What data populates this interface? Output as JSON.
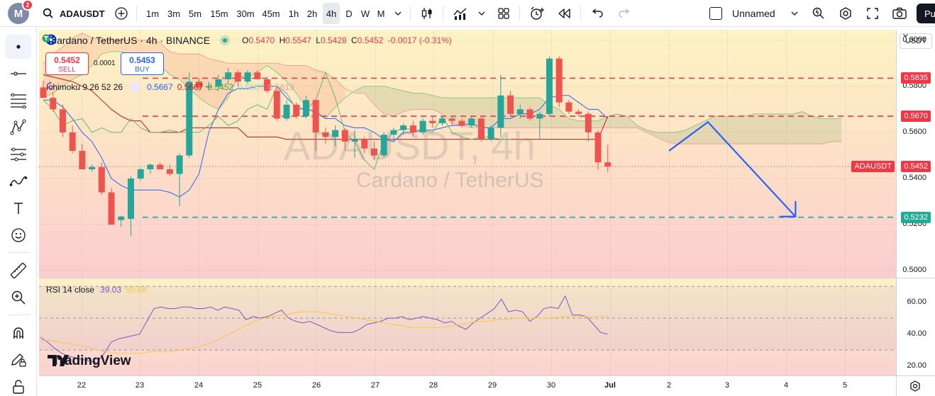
{
  "toolbar": {
    "avatar_letter": "M",
    "notifications": "2",
    "symbol": "ADAUSDT",
    "intervals": [
      "1m",
      "3m",
      "5m",
      "15m",
      "30m",
      "45m",
      "1h",
      "2h",
      "4h",
      "D",
      "W",
      "M"
    ],
    "selected_interval": "4h",
    "layout_name": "Unnamed",
    "publish_label": "Pu"
  },
  "legend": {
    "title": "Cardano / TetherUS · 4h · BINANCE",
    "o_label": "O",
    "o": "0.5470",
    "h_label": "H",
    "h": "0.5547",
    "l_label": "L",
    "l": "0.5428",
    "c_label": "C",
    "c": "0.5452",
    "change": "-0.0017 (-0.31%)",
    "sell_price": "0.5452",
    "sell_label": "SELL",
    "spread": "0.0001",
    "buy_price": "0.5453",
    "buy_label": "BUY",
    "ichimoku_name": "Ichimoku 9 26 52 26",
    "ichimoku_values": [
      "0.5667",
      "0.5667",
      "0.5452",
      "0.5667",
      "0.5613"
    ],
    "rsi_name": "RSI 14 close",
    "rsi_values": [
      "39.03",
      "50.68"
    ]
  },
  "watermark": {
    "symbol": "ADAUSDT, 4h",
    "name": "Cardano / TetherUS"
  },
  "brand": "TradingView",
  "currency": "USDT",
  "colors": {
    "up": "#26a69a",
    "down": "#ef5350",
    "blue": "#2962ff",
    "purple": "#7e57c2",
    "rsi_ma": "#f7c948"
  },
  "price_axis": {
    "ticks": [
      "0.6000",
      "0.5800",
      "0.5600",
      "0.5400",
      "0.5200",
      "0.5000"
    ],
    "tick_values": [
      0.6,
      0.58,
      0.56,
      0.54,
      0.52,
      0.5
    ],
    "labels": [
      {
        "value": 0.5835,
        "text": "0.5835",
        "color": "#f23645"
      },
      {
        "value": 0.567,
        "text": "0.5670",
        "color": "#f23645"
      },
      {
        "value": 0.5452,
        "text": "0.5452",
        "color": "#f23645",
        "tag": "ADAUSDT"
      },
      {
        "value": 0.5232,
        "text": "0.5232",
        "color": "#22ab94"
      }
    ]
  },
  "rsi_axis": {
    "ticks": [
      "60.00",
      "40.00",
      "20.00"
    ],
    "tick_values": [
      60,
      40,
      20
    ]
  },
  "time_axis": {
    "labels": [
      "22",
      "23",
      "24",
      "25",
      "26",
      "27",
      "28",
      "29",
      "30",
      "Jul",
      "2",
      "3",
      "4",
      "5"
    ],
    "bold": "Jul"
  },
  "chart_data": {
    "type": "candlestick",
    "title": "Cardano / TetherUS · 4h · BINANCE",
    "ylim": [
      0.497,
      0.6045
    ],
    "levels": [
      {
        "name": "resistance-1",
        "value": 0.5835,
        "color": "#f23645"
      },
      {
        "name": "resistance-2",
        "value": 0.567,
        "color": "#f23645"
      },
      {
        "name": "support",
        "value": 0.5232,
        "color": "#22ab94"
      }
    ],
    "projection": [
      [
        0,
        0.552
      ],
      [
        4,
        0.5645
      ],
      [
        13,
        0.5235
      ]
    ],
    "candles": [
      [
        0.5795,
        0.5825,
        0.576,
        0.575
      ],
      [
        0.575,
        0.5775,
        0.569,
        0.57
      ],
      [
        0.57,
        0.572,
        0.558,
        0.56
      ],
      [
        0.56,
        0.563,
        0.551,
        0.552
      ],
      [
        0.552,
        0.555,
        0.547,
        0.544
      ],
      [
        0.544,
        0.546,
        0.543,
        0.545
      ],
      [
        0.545,
        0.547,
        0.533,
        0.534
      ],
      [
        0.534,
        0.536,
        0.521,
        0.52
      ],
      [
        0.522,
        0.524,
        0.519,
        0.5235
      ],
      [
        0.5225,
        0.541,
        0.515,
        0.54
      ],
      [
        0.54,
        0.5445,
        0.539,
        0.544
      ],
      [
        0.544,
        0.5465,
        0.542,
        0.546
      ],
      [
        0.546,
        0.547,
        0.544,
        0.544
      ],
      [
        0.544,
        0.546,
        0.541,
        0.542
      ],
      [
        0.542,
        0.551,
        0.528,
        0.55
      ],
      [
        0.55,
        0.586,
        0.549,
        0.582
      ],
      [
        0.582,
        0.5835,
        0.578,
        0.5795
      ],
      [
        0.5795,
        0.582,
        0.578,
        0.58
      ],
      [
        0.58,
        0.585,
        0.578,
        0.583
      ],
      [
        0.583,
        0.588,
        0.581,
        0.586
      ],
      [
        0.586,
        0.587,
        0.58,
        0.582
      ],
      [
        0.582,
        0.587,
        0.581,
        0.586
      ],
      [
        0.586,
        0.587,
        0.583,
        0.583
      ],
      [
        0.583,
        0.584,
        0.577,
        0.578
      ],
      [
        0.578,
        0.58,
        0.565,
        0.566
      ],
      [
        0.566,
        0.574,
        0.565,
        0.572
      ],
      [
        0.572,
        0.573,
        0.566,
        0.567
      ],
      [
        0.567,
        0.576,
        0.566,
        0.574
      ],
      [
        0.574,
        0.5745,
        0.552,
        0.56
      ],
      [
        0.56,
        0.562,
        0.555,
        0.558
      ],
      [
        0.558,
        0.563,
        0.554,
        0.561
      ],
      [
        0.561,
        0.562,
        0.552,
        0.556
      ],
      [
        0.556,
        0.561,
        0.549,
        0.557
      ],
      [
        0.557,
        0.558,
        0.551,
        0.553
      ],
      [
        0.553,
        0.556,
        0.548,
        0.55
      ],
      [
        0.55,
        0.56,
        0.549,
        0.559
      ],
      [
        0.559,
        0.562,
        0.556,
        0.561
      ],
      [
        0.561,
        0.564,
        0.559,
        0.563
      ],
      [
        0.563,
        0.565,
        0.558,
        0.56
      ],
      [
        0.56,
        0.566,
        0.559,
        0.565
      ],
      [
        0.565,
        0.567,
        0.562,
        0.564
      ],
      [
        0.564,
        0.567,
        0.563,
        0.566
      ],
      [
        0.566,
        0.567,
        0.563,
        0.565
      ],
      [
        0.565,
        0.566,
        0.562,
        0.563
      ],
      [
        0.563,
        0.567,
        0.562,
        0.566
      ],
      [
        0.566,
        0.567,
        0.556,
        0.557
      ],
      [
        0.557,
        0.563,
        0.556,
        0.562
      ],
      [
        0.562,
        0.585,
        0.558,
        0.576
      ],
      [
        0.576,
        0.578,
        0.567,
        0.568
      ],
      [
        0.568,
        0.572,
        0.566,
        0.57
      ],
      [
        0.57,
        0.571,
        0.565,
        0.566
      ],
      [
        0.566,
        0.569,
        0.557,
        0.568
      ],
      [
        0.568,
        0.593,
        0.567,
        0.592
      ],
      [
        0.592,
        0.593,
        0.571,
        0.573
      ],
      [
        0.573,
        0.574,
        0.568,
        0.569
      ],
      [
        0.569,
        0.57,
        0.567,
        0.568
      ],
      [
        0.568,
        0.569,
        0.556,
        0.56
      ],
      [
        0.56,
        0.561,
        0.544,
        0.547
      ],
      [
        0.547,
        0.5547,
        0.5428,
        0.5452
      ]
    ],
    "ichimoku": {
      "conversion": [
        0.574,
        0.574,
        0.571,
        0.566,
        0.56,
        0.556,
        0.549,
        0.54,
        0.537,
        0.535,
        0.535,
        0.535,
        0.535,
        0.534,
        0.532,
        0.535,
        0.542,
        0.56,
        0.57,
        0.577,
        0.579,
        0.579,
        0.58,
        0.58,
        0.58,
        0.575,
        0.571,
        0.57,
        0.569,
        0.566,
        0.566,
        0.563,
        0.562,
        0.562,
        0.56,
        0.557,
        0.556,
        0.56,
        0.56,
        0.561,
        0.561,
        0.562,
        0.563,
        0.563,
        0.564,
        0.562,
        0.562,
        0.566,
        0.566,
        0.568,
        0.568,
        0.57,
        0.575,
        0.576,
        0.576,
        0.573,
        0.57,
        0.57,
        0.566
      ],
      "base": [
        0.585,
        0.584,
        0.583,
        0.582,
        0.58,
        0.578,
        0.574,
        0.57,
        0.567,
        0.565,
        0.565,
        0.56,
        0.56,
        0.56,
        0.56,
        0.562,
        0.562,
        0.562,
        0.562,
        0.562,
        0.562,
        0.558,
        0.558,
        0.558,
        0.558,
        0.557,
        0.557,
        0.557,
        0.557,
        0.557,
        0.557,
        0.557,
        0.557,
        0.557,
        0.557,
        0.557,
        0.557,
        0.557,
        0.557,
        0.557,
        0.557,
        0.557,
        0.557,
        0.557,
        0.557,
        0.557,
        0.557,
        0.557,
        0.557,
        0.557,
        0.557,
        0.557,
        0.557,
        0.557,
        0.557,
        0.557,
        0.557,
        0.557,
        0.567
      ],
      "lagging": [
        0.574,
        0.57,
        0.563,
        0.565,
        0.566,
        0.56,
        0.562,
        0.56,
        0.56,
        0.566,
        0.562,
        0.56,
        0.56,
        0.561,
        0.56,
        0.56,
        0.56,
        0.563,
        0.567,
        0.563,
        0.565,
        0.57,
        0.572,
        0.57,
        0.58,
        0.577,
        0.57,
        0.57,
        0.574,
        0.586,
        0.575,
        0.56,
        0.556,
        0.548,
        0.544,
        0.556,
        0.56,
        0.562,
        0.561,
        0.561,
        0.56,
        0.567,
        0.56,
        0.558,
        0.557,
        0.558,
        0.558,
        0.557,
        0.557
      ],
      "span_a": [
        0.575,
        0.577,
        0.58,
        0.583,
        0.585,
        0.589,
        0.594,
        0.595,
        0.595,
        0.594,
        0.593,
        0.59,
        0.589,
        0.585,
        0.583,
        0.579,
        0.575,
        0.572,
        0.57,
        0.575,
        0.584,
        0.584,
        0.586,
        0.589,
        0.586,
        0.582,
        0.577,
        0.571,
        0.568,
        0.566,
        0.571,
        0.575,
        0.578,
        0.58,
        0.58,
        0.58,
        0.579,
        0.578,
        0.577,
        0.577,
        0.576,
        0.575,
        0.575,
        0.575,
        0.575,
        0.575,
        0.575,
        0.575,
        0.575,
        0.575,
        0.575,
        0.575,
        0.572,
        0.57,
        0.566,
        0.565,
        0.565,
        0.565,
        0.567,
        0.568,
        0.567,
        0.563,
        0.561,
        0.56,
        0.56,
        0.56,
        0.561,
        0.563,
        0.565,
        0.567,
        0.567,
        0.567,
        0.567,
        0.568,
        0.568,
        0.568,
        0.568,
        0.568,
        0.569,
        0.567,
        0.566,
        0.566,
        0.566
      ],
      "span_b": [
        0.59,
        0.594,
        0.597,
        0.601,
        0.603,
        0.601,
        0.6,
        0.6,
        0.6,
        0.6,
        0.6,
        0.6,
        0.599,
        0.595,
        0.594,
        0.594,
        0.594,
        0.592,
        0.591,
        0.59,
        0.59,
        0.59,
        0.59,
        0.59,
        0.59,
        0.589,
        0.589,
        0.589,
        0.587,
        0.586,
        0.583,
        0.579,
        0.577,
        0.577,
        0.572,
        0.568,
        0.567,
        0.569,
        0.57,
        0.57,
        0.57,
        0.568,
        0.564,
        0.563,
        0.562,
        0.562,
        0.562,
        0.562,
        0.562,
        0.562,
        0.562,
        0.562,
        0.562,
        0.562,
        0.562,
        0.562,
        0.562,
        0.562,
        0.562,
        0.562,
        0.562,
        0.562,
        0.56,
        0.558,
        0.556,
        0.555,
        0.555,
        0.555,
        0.555,
        0.555,
        0.555,
        0.555,
        0.555,
        0.555,
        0.555,
        0.555,
        0.555,
        0.555,
        0.555,
        0.555,
        0.555,
        0.556,
        0.556
      ]
    },
    "rsi": {
      "ylim": [
        14,
        75
      ],
      "bands": [
        70,
        50,
        30
      ],
      "values": [
        38,
        35,
        31,
        28,
        26,
        25,
        24,
        23,
        22,
        28,
        35,
        37,
        38,
        39,
        40,
        48,
        56,
        57,
        56,
        56,
        57,
        57,
        56,
        56,
        57,
        55,
        57,
        56,
        55,
        49,
        51,
        50,
        51,
        53,
        55,
        50,
        48,
        47,
        48,
        46,
        44,
        42,
        41,
        41,
        41,
        43,
        46,
        47,
        48,
        50,
        50,
        51,
        49,
        50,
        51,
        50,
        49,
        47,
        48,
        45,
        43,
        47,
        50,
        53,
        56,
        62,
        54,
        55,
        54,
        48,
        51,
        56,
        57,
        56,
        64,
        52,
        52,
        51,
        46,
        41,
        40
      ],
      "ma": [
        36,
        36,
        35,
        34,
        33,
        32,
        30,
        29,
        28,
        28,
        28,
        28,
        29,
        29,
        29,
        30,
        31,
        32,
        34,
        36,
        39,
        42,
        45,
        48,
        50,
        51,
        52,
        53,
        54,
        54,
        54,
        53,
        52,
        51,
        50,
        49,
        48,
        47,
        46,
        45,
        44,
        44,
        44,
        44,
        45,
        46,
        47,
        48,
        48,
        49,
        49,
        50,
        50,
        50,
        50,
        50,
        51,
        51,
        51,
        51,
        51,
        51
      ]
    }
  }
}
